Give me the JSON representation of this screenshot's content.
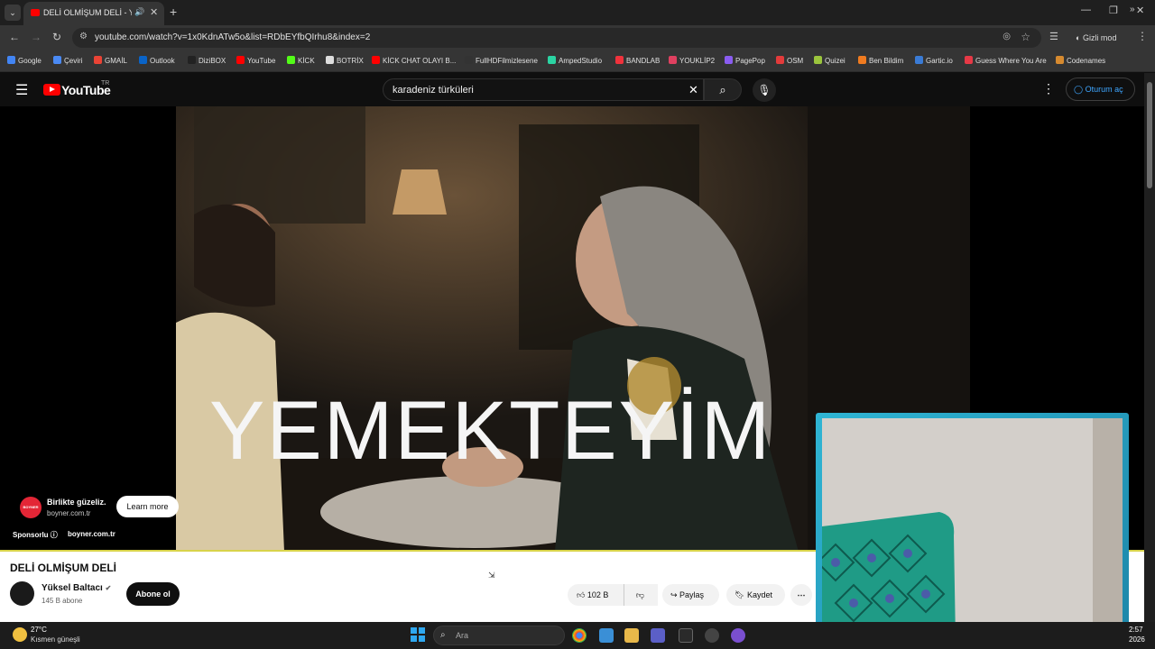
{
  "browser": {
    "tab": {
      "title": "DELİ OLMİŞUM DELİ - YouTube"
    },
    "url": "youtube.com/watch?v=1x0KdnATw5o&list=RDbEYfbQIrhu8&index=2",
    "incognito_label": "Gizli mod",
    "bookmarks": [
      {
        "label": "Google",
        "color": "#4285f4"
      },
      {
        "label": "Çeviri",
        "color": "#4a8af4"
      },
      {
        "label": "GMAİL",
        "color": "#ea4335"
      },
      {
        "label": "Outlook",
        "color": "#0a64c8"
      },
      {
        "label": "DiziBOX",
        "color": "#222222"
      },
      {
        "label": "YouTube",
        "color": "#ff0000"
      },
      {
        "label": "KİCK",
        "color": "#53fc18"
      },
      {
        "label": "BOTRİX",
        "color": "#dddddd"
      },
      {
        "label": "KİCK CHAT OLAYI B...",
        "color": "#ff0000"
      },
      {
        "label": "FullHDFilmizlesene",
        "color": "#333333"
      },
      {
        "label": "AmpedStudio",
        "color": "#2bd4a3"
      },
      {
        "label": "BANDLAB",
        "color": "#f0323c"
      },
      {
        "label": "YOUKLİP2",
        "color": "#e04060"
      },
      {
        "label": "PagePop",
        "color": "#8a5cf0"
      },
      {
        "label": "OSM",
        "color": "#e33b3b"
      },
      {
        "label": "Quizei",
        "color": "#9bc53d"
      },
      {
        "label": "Ben Bildim",
        "color": "#f07b20"
      },
      {
        "label": "Gartic.io",
        "color": "#3a7bd5"
      },
      {
        "label": "Guess Where You Are",
        "color": "#e63946"
      },
      {
        "label": "Codenames",
        "color": "#d68a2f"
      }
    ]
  },
  "youtube": {
    "logo_text": "YouTube",
    "country_code": "TR",
    "search_value": "karadeniz türküleri",
    "signin_label": "Oturum aç"
  },
  "video": {
    "caption_text": "YEMEKTEYİM",
    "title": "DELİ OLMİŞUM DELİ",
    "channel": "Yüksel Baltacı",
    "subscribers": "145 B abone",
    "subscribe_label": "Abone ol",
    "likes": "102 B",
    "share_label": "Paylaş",
    "save_label": "Kaydet"
  },
  "ad": {
    "icon_text": "BOYNER",
    "headline": "Birlikte güzeliz.",
    "domain": "boyner.com.tr",
    "learn_more": "Learn more",
    "sponsored": "Sponsorlu",
    "domain2": "boyner.com.tr"
  },
  "taskbar": {
    "temperature": "27°C",
    "weather": "Kısmen güneşli",
    "search_placeholder": "Ara",
    "time": "2:57",
    "date": "2026"
  }
}
